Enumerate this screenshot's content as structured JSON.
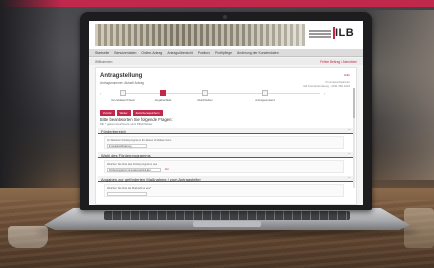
{
  "site": {
    "logo": "ILB",
    "nav": [
      "Startseite",
      "Benutzerdaten",
      "Online-Antrag",
      "Antragsübersicht",
      "Postbox",
      "Profilpflege",
      "Änderung der Kundendaten"
    ],
    "breadcrumb": "Willkommen",
    "login_link": "Fehler Beitrag / Abmelden"
  },
  "form": {
    "title": "Antragstellung",
    "subtitle": "Antragsnummer: Aktuell Antrag",
    "help": "Hilfe",
    "meta_line1": "Ihr Ansprechpartner",
    "meta_line2": "ILB Kundenberatung · 0331 660 2222",
    "steps": [
      {
        "label": "Grunddaten/Check",
        "active": false
      },
      {
        "label": "Angabenblatt",
        "active": true
      },
      {
        "label": "Abschließen",
        "active": false
      },
      {
        "label": "Antragsversand",
        "active": false
      }
    ],
    "buttons": [
      "Zurück",
      "Weiter",
      "Zwischenspeichern"
    ],
    "question": "Bitte beantworten Sie folgende Fragen:",
    "question_note": "Mit * gekennzeichnete sind Pflichtfelder",
    "sections": [
      {
        "title": "Förderbereich",
        "field_label": "Im Weiteren Förderprogramm für dieses Vorhaben beim",
        "field_value": "Innovationsförderung",
        "unit": ""
      },
      {
        "title": "Wahl des Förderprogramms",
        "field_label": "Welchen Sie bitte das Förderprogramm aus",
        "field_value": "Förderprogramm Innovationsschub-Eur",
        "unit": "Zur"
      },
      {
        "title": "Angaben zur geförderten Maßnahme / zum Antragsteller",
        "field_label": "Welchen Sie bitte die Maßnahme aus*",
        "field_value": "",
        "unit": ""
      }
    ]
  },
  "colors": {
    "accent": "#c0284c",
    "screen_bg": "#f4f4f4"
  }
}
